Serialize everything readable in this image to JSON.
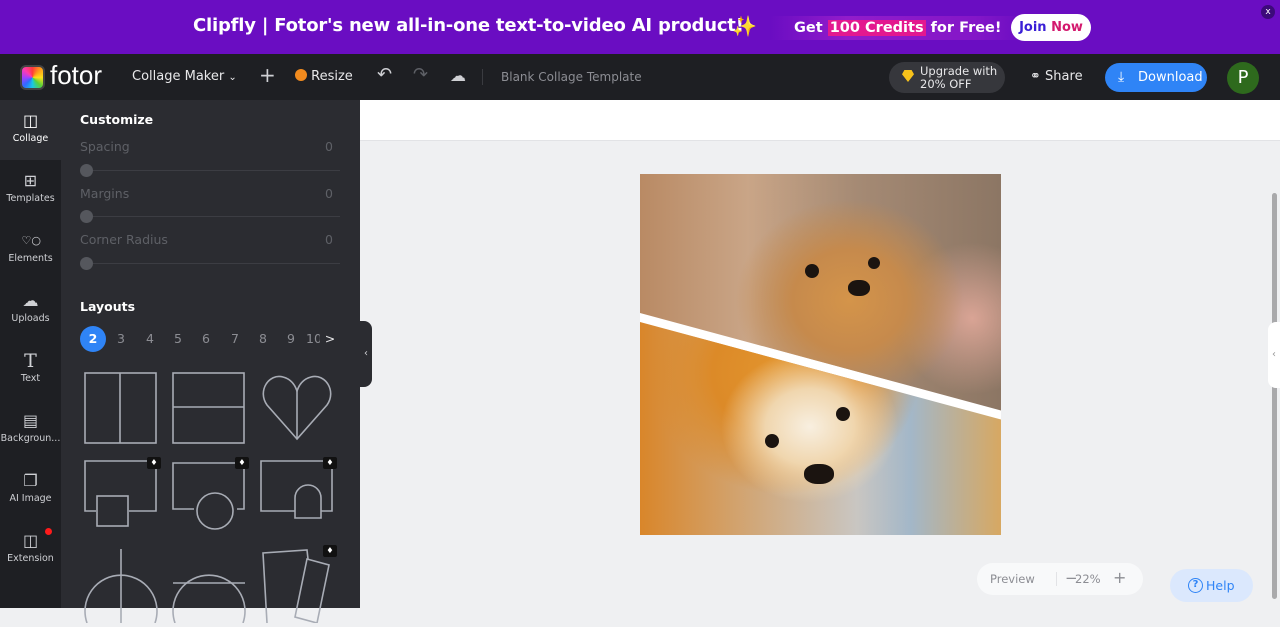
{
  "banner": {
    "headline": "Clipfly | Fotor's new all-in-one text-to-video AI product!",
    "sparkle_icon": "sparkles-icon",
    "offer_prefix": "Get ",
    "offer_number": "100 Credits",
    "offer_suffix": " for Free!",
    "join_part1": "Join ",
    "join_part2": "Now",
    "close_label": "x"
  },
  "topbar": {
    "logo_text": "fotor",
    "mode_label": "Collage Maker",
    "add_label": "+",
    "resize_label": "Resize",
    "document_title": "Blank Collage Template",
    "upgrade_line1": "Upgrade with",
    "upgrade_line2": "20% OFF",
    "share_label": "Share",
    "download_label": "Download",
    "avatar_initial": "P"
  },
  "rail": {
    "items": [
      {
        "label": "Collage",
        "icon": "collage-icon",
        "active": true
      },
      {
        "label": "Templates",
        "icon": "templates-icon"
      },
      {
        "label": "Elements",
        "icon": "elements-icon"
      },
      {
        "label": "Uploads",
        "icon": "upload-cloud-icon"
      },
      {
        "label": "Text",
        "icon": "text-icon"
      },
      {
        "label": "Backgroun...",
        "icon": "background-icon"
      },
      {
        "label": "AI Image",
        "icon": "ai-image-icon"
      },
      {
        "label": "Extension",
        "icon": "extension-icon",
        "badge": "new-dot"
      }
    ]
  },
  "panel": {
    "customize_title": "Customize",
    "sliders": [
      {
        "label": "Spacing",
        "value": "0"
      },
      {
        "label": "Margins",
        "value": "0"
      },
      {
        "label": "Corner Radius",
        "value": "0"
      }
    ],
    "layouts_title": "Layouts",
    "page_numbers": [
      "2",
      "3",
      "4",
      "5",
      "6",
      "7",
      "8",
      "9",
      "10"
    ],
    "selected_page": "2",
    "next_label": ">",
    "layouts": [
      {
        "name": "two-vertical",
        "premium": false
      },
      {
        "name": "two-horizontal",
        "premium": false
      },
      {
        "name": "heart-split",
        "premium": false
      },
      {
        "name": "rect-with-square",
        "premium": true
      },
      {
        "name": "rect-with-circle",
        "premium": true
      },
      {
        "name": "rect-with-arch",
        "premium": true
      },
      {
        "name": "circle-vertical-split",
        "premium": false
      },
      {
        "name": "circle-horizontal-split",
        "premium": false
      },
      {
        "name": "tilted-frames",
        "premium": true
      }
    ]
  },
  "canvas": {
    "collage_photos": [
      "Pomeranian dog photo",
      "Shiba Inu dog photo"
    ]
  },
  "footer": {
    "preview_label": "Preview",
    "zoom_minus": "−",
    "zoom_value": "22%",
    "zoom_plus": "+",
    "help_label": "Help"
  },
  "colors": {
    "banner_bg": "#6a0dc2",
    "accent_blue": "#2f84f6",
    "avatar_green": "#2e6a1d",
    "panel_bg": "#2b2c31",
    "topbar_bg": "#1e1f23"
  }
}
